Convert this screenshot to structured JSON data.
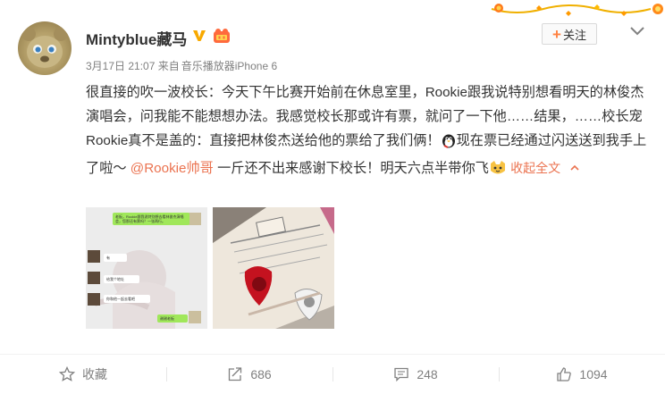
{
  "user": {
    "name": "Mintyblue藏马",
    "time": "3月17日 21:07",
    "source_prefix": "来自",
    "source": "音乐播放器iPhone 6"
  },
  "follow_label": "关注",
  "post": {
    "text_before": "很直接的吹一波校长：今天下午比赛开始前在休息室里，Rookie跟我说特别想看明天的林俊杰演唱会，问我能不能想想办法。我感觉校长那或许有票，就问了一下他……结果，……校长宠Rookie真不是盖的：直接把林俊杰送给他的票给了我们俩！",
    "text_mid": "现在票已经通过闪送送到我手上了啦～ ",
    "mention": "@Rookie帅哥",
    "text_after": " 一斤还不出来感谢下校长！明天六点半带你飞",
    "collapse_label": "收起全文"
  },
  "chat_screenshot": {
    "msg1": "老板，Rookie跟我说特别想去看林俊杰演唱会，您那还有票吗？一张两行。",
    "msg2": "有",
    "msg3": "给我个地址",
    "msg4": "你和他一起去看吧",
    "msg5": "谢谢老板"
  },
  "actions": {
    "favorite": "收藏",
    "repost": "686",
    "comment": "248",
    "like": "1094"
  },
  "colors": {
    "accent": "#eb7350",
    "vip": "#f8a900",
    "text": "#333333",
    "muted": "#808080"
  }
}
